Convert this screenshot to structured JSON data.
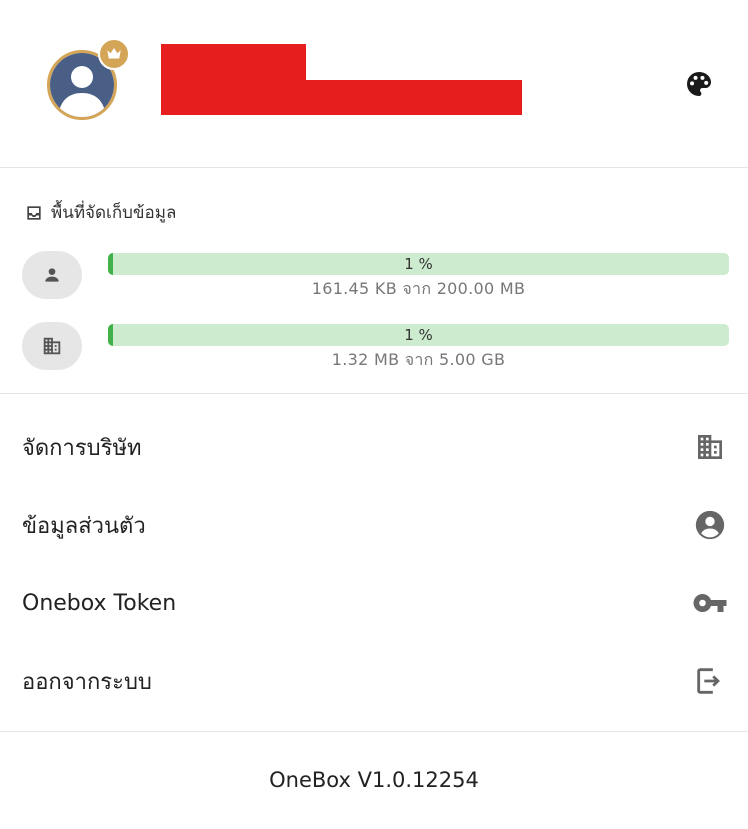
{
  "header": {
    "avatar_icon": "user-avatar",
    "badge_icon": "crown-icon",
    "theme_icon": "palette-icon",
    "colors": {
      "gold": "#d4a556",
      "redaction": "#e61e1e"
    }
  },
  "storage": {
    "title": "พื้นที่จัดเก็บข้อมูล",
    "title_icon": "inbox-icon",
    "quotas": [
      {
        "icon": "person-icon",
        "percent_label": "1 %",
        "usage_text": "161.45 KB จาก 200.00 MB",
        "fill_fraction": 0.008
      },
      {
        "icon": "business-icon",
        "percent_label": "1 %",
        "usage_text": "1.32 MB จาก 5.00 GB",
        "fill_fraction": 0.008
      }
    ],
    "colors": {
      "bar_bg": "#cdeccf",
      "bar_fill": "#43b14a"
    }
  },
  "menu": [
    {
      "label": "จัดการบริษัท",
      "icon": "business-icon"
    },
    {
      "label": "ข้อมูลส่วนตัว",
      "icon": "account-circle-icon"
    },
    {
      "label": "Onebox Token",
      "icon": "key-icon"
    },
    {
      "label": "ออกจากระบบ",
      "icon": "logout-icon"
    }
  ],
  "footer": {
    "version": "OneBox V1.0.12254"
  }
}
